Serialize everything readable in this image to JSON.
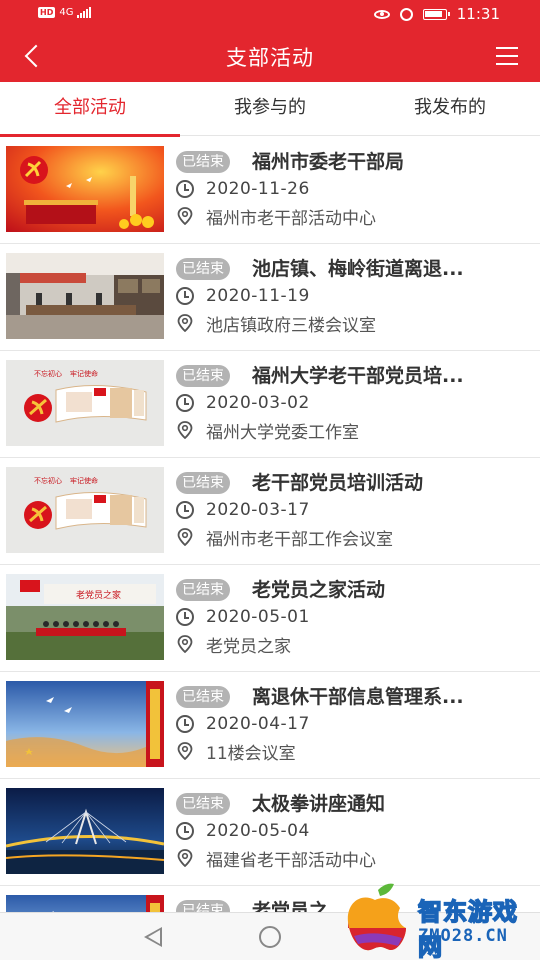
{
  "status_bar": {
    "hd": "HD",
    "network": "4G",
    "time": "11:31"
  },
  "nav": {
    "title": "支部活动"
  },
  "tabs": [
    {
      "label": "全部活动",
      "active": true
    },
    {
      "label": "我参与的",
      "active": false
    },
    {
      "label": "我发布的",
      "active": false
    }
  ],
  "activities": [
    {
      "status": "已结束",
      "title": "福州市委老干部局",
      "date": "2020-11-26",
      "location": "福州市老干部活动中心",
      "image": "party-flag-tiananmen"
    },
    {
      "status": "已结束",
      "title": "池店镇、梅岭街道离退...",
      "date": "2020-11-19",
      "location": "池店镇政府三楼会议室",
      "image": "meeting-room"
    },
    {
      "status": "已结束",
      "title": "福州大学老干部党员培...",
      "date": "2020-03-02",
      "location": "福州大学党委工作室",
      "image": "party-wall"
    },
    {
      "status": "已结束",
      "title": "老干部党员培训活动",
      "date": "2020-03-17",
      "location": "福州市老干部工作会议室",
      "image": "party-wall"
    },
    {
      "status": "已结束",
      "title": "老党员之家活动",
      "date": "2020-05-01",
      "location": "老党员之家",
      "image": "group-photo"
    },
    {
      "status": "已结束",
      "title": "离退休干部信息管理系...",
      "date": "2020-04-17",
      "location": "11楼会议室",
      "image": "sky-doves"
    },
    {
      "status": "已结束",
      "title": "太极拳讲座通知",
      "date": "2020-05-04",
      "location": "福建省老干部活动中心",
      "image": "bridge-night"
    },
    {
      "status": "已结束",
      "title": "老党员之...",
      "date": "",
      "location": "",
      "image": "sky-doves"
    }
  ],
  "watermark": {
    "text_cn": "智东游戏网",
    "text_en": "ZMO28.CN"
  },
  "colors": {
    "primary": "#e3262e",
    "badge": "#b3b3b3"
  }
}
